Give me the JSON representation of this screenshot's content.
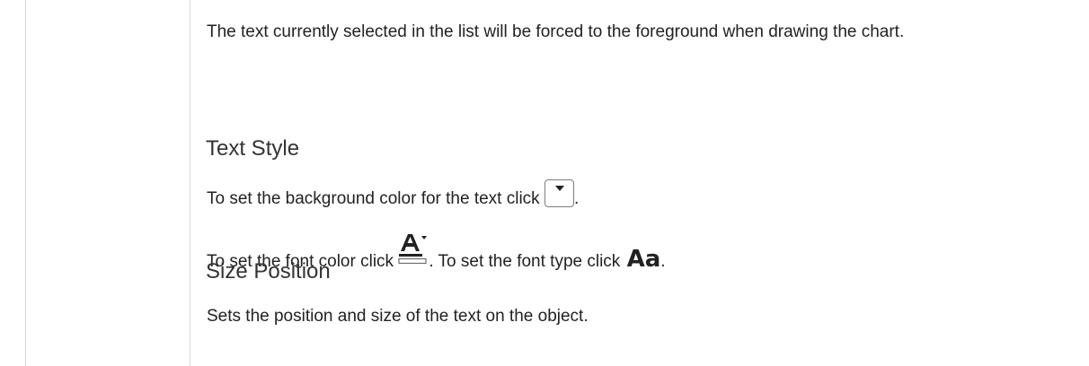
{
  "intro": {
    "text": "The text currently selected in the list will be forced to the foreground when drawing the chart."
  },
  "text_style": {
    "heading": "Text Style",
    "background_line": "To set the background color for the text click",
    "font_color_line": "To set the font color click",
    "font_type_line": ". To set the font type click",
    "font_type_icon_text": "Aa"
  },
  "size_position": {
    "heading": "Size Position",
    "description": "Sets the position and size of the text on the object."
  }
}
